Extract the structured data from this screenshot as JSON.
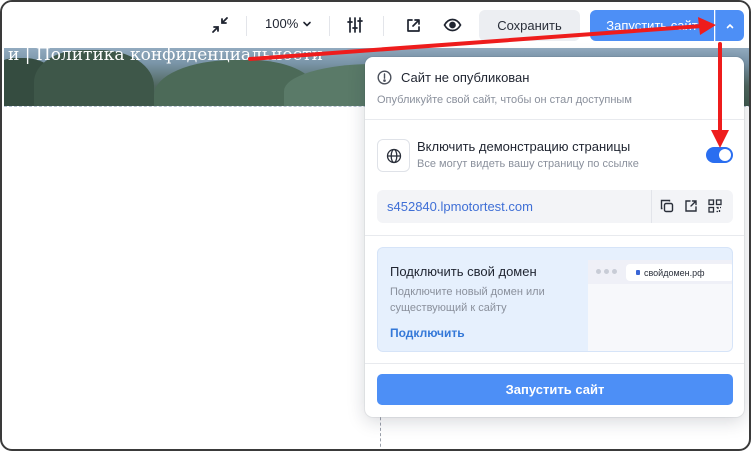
{
  "toolbar": {
    "zoom_value": "100%",
    "save_label": "Сохранить",
    "launch_label": "Запустить сайт"
  },
  "canvas": {
    "hero_text": "и | Политика конфиденциальности"
  },
  "publish_popup": {
    "status_title": "Сайт не опубликован",
    "status_subtitle": "Опубликуйте свой сайт, чтобы он стал доступным",
    "demo_title": "Включить демонстрацию страницы",
    "demo_subtitle": "Все могут видеть вашу страницу по ссылке",
    "demo_enabled": true,
    "site_url": "s452840.lpmotortest.com",
    "domain_title": "Подключить свой домен",
    "domain_subtitle": "Подключите новый домен или существующий к сайту",
    "domain_link": "Подключить",
    "domain_preview": "свойдомен.рф",
    "launch_label": "Запустить сайт"
  },
  "colors": {
    "accent": "#4d8ff6",
    "toggle_on": "#2a6ef0",
    "annotation_arrow": "#ee1c1c"
  },
  "icons": [
    "collapse-icon",
    "chevron-down-icon",
    "settings-sliders-icon",
    "external-link-icon",
    "eye-icon",
    "chevron-up-icon",
    "info-circle-icon",
    "globe-icon",
    "copy-icon",
    "qr-code-icon"
  ]
}
